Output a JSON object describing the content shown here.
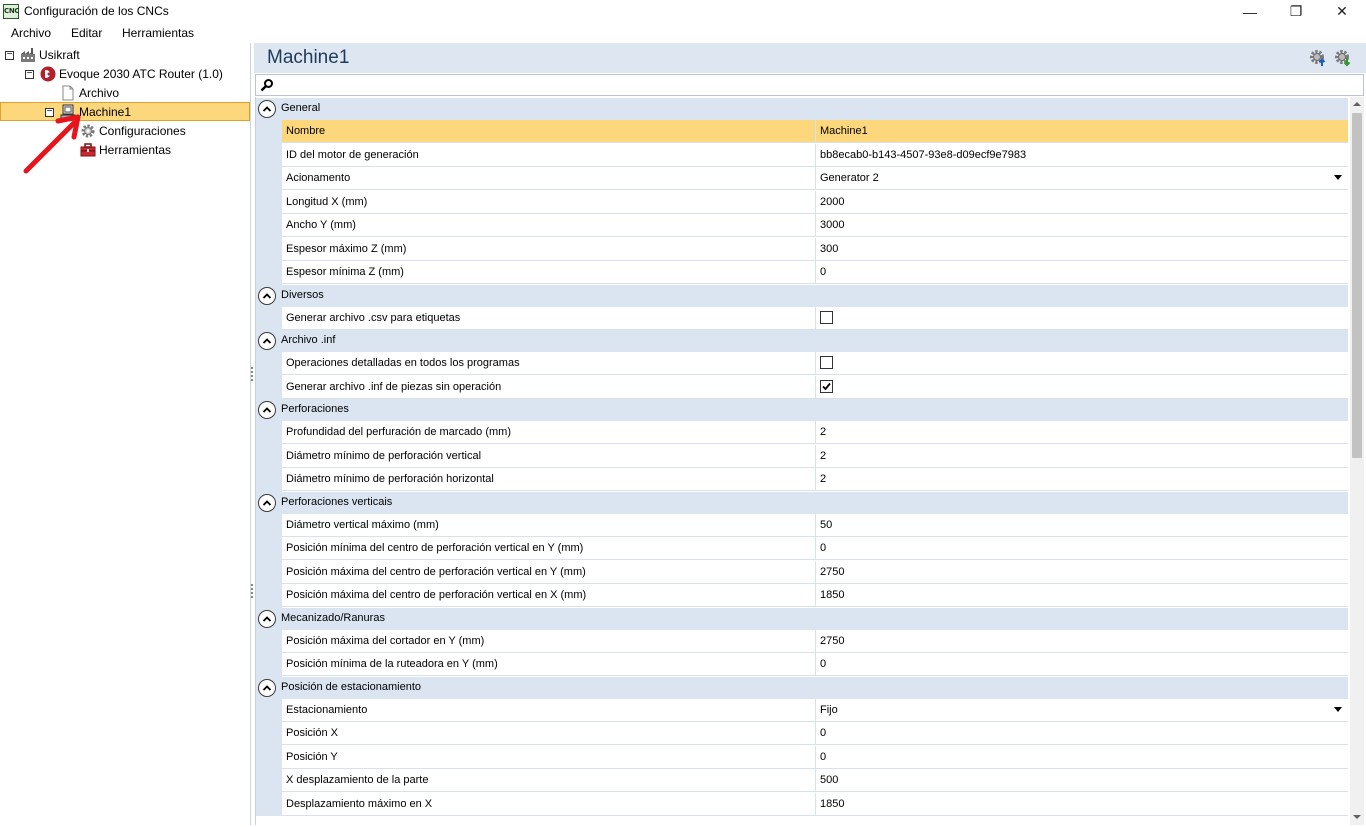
{
  "window": {
    "title": "Configuración de los CNCs",
    "app_icon_text": "CNC",
    "minimize": "—",
    "maximize": "❐",
    "close": "✕"
  },
  "menu": {
    "items": [
      "Archivo",
      "Editar",
      "Herramientas"
    ]
  },
  "tree": {
    "root": "Usikraft",
    "router": "Evoque 2030 ATC Router (1.0)",
    "archivo": "Archivo",
    "machine": "Machine1",
    "configuraciones": "Configuraciones",
    "herramientas": "Herramientas"
  },
  "panel": {
    "title": "Machine1",
    "search_placeholder": ""
  },
  "grid": {
    "categories": [
      {
        "label": "General",
        "rows": [
          {
            "name": "Nombre",
            "value": "Machine1",
            "type": "text",
            "selected": true
          },
          {
            "name": "ID del motor de generación",
            "value": "bb8ecab0-b143-4507-93e8-d09ecf9e7983",
            "type": "text"
          },
          {
            "name": "Acionamento",
            "value": "Generator 2",
            "type": "dropdown"
          },
          {
            "name": "Longitud X (mm)",
            "value": "2000",
            "type": "text"
          },
          {
            "name": "Ancho Y (mm)",
            "value": "3000",
            "type": "text"
          },
          {
            "name": "Espesor máximo Z (mm)",
            "value": "300",
            "type": "text"
          },
          {
            "name": "Espesor mínima Z (mm)",
            "value": "0",
            "type": "text"
          }
        ]
      },
      {
        "label": "Diversos",
        "rows": [
          {
            "name": "Generar archivo .csv para etiquetas",
            "value": "",
            "type": "checkbox",
            "checked": false
          }
        ]
      },
      {
        "label": "Archivo .inf",
        "rows": [
          {
            "name": "Operaciones detalladas en todos los programas",
            "value": "",
            "type": "checkbox",
            "checked": false
          },
          {
            "name": "Generar archivo .inf de piezas sin operación",
            "value": "",
            "type": "checkbox",
            "checked": true
          }
        ]
      },
      {
        "label": "Perforaciones",
        "rows": [
          {
            "name": "Profundidad del perfuración de marcado (mm)",
            "value": "2",
            "type": "text"
          },
          {
            "name": "Diámetro mínimo de perforación vertical",
            "value": "2",
            "type": "text"
          },
          {
            "name": "Diámetro mínimo de perforación horizontal",
            "value": "2",
            "type": "text"
          }
        ]
      },
      {
        "label": "Perforaciones verticais",
        "rows": [
          {
            "name": "Diámetro vertical máximo (mm)",
            "value": "50",
            "type": "text"
          },
          {
            "name": "Posición mínima del centro de perforación vertical en Y (mm)",
            "value": "0",
            "type": "text"
          },
          {
            "name": "Posición máxima del centro de perforación vertical en Y (mm)",
            "value": "2750",
            "type": "text"
          },
          {
            "name": "Posición máxima del centro de perforación vertical en X (mm)",
            "value": "1850",
            "type": "text"
          }
        ]
      },
      {
        "label": "Mecanizado/Ranuras",
        "rows": [
          {
            "name": "Posición máxima del cortador en Y (mm)",
            "value": "2750",
            "type": "text"
          },
          {
            "name": "Posición mínima de la ruteadora en Y (mm)",
            "value": "0",
            "type": "text"
          }
        ]
      },
      {
        "label": "Posición de estacionamiento",
        "rows": [
          {
            "name": "Estacionamiento",
            "value": "Fijo",
            "type": "dropdown"
          },
          {
            "name": "Posición X",
            "value": "0",
            "type": "text"
          },
          {
            "name": "Posición Y",
            "value": "0",
            "type": "text"
          },
          {
            "name": "X desplazamiento de la parte",
            "value": "500",
            "type": "text"
          },
          {
            "name": "Desplazamiento máximo en X",
            "value": "1850",
            "type": "text"
          }
        ]
      }
    ]
  },
  "colors": {
    "selection": "#fcd77b",
    "category_bg": "#dbe5f1",
    "header_bg": "#dde6f1",
    "annotation_arrow": "#e8141c"
  },
  "annotation": {
    "arrow_icon": "red-arrow-icon"
  }
}
